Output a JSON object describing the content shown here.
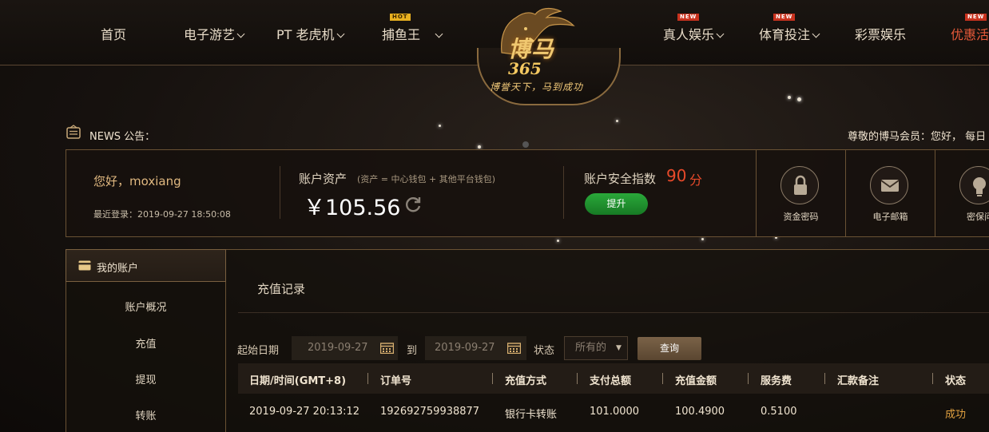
{
  "nav": {
    "left": [
      {
        "label": "首页",
        "dropdown": false
      },
      {
        "label": "电子游艺",
        "dropdown": true
      },
      {
        "label": "PT 老虎机",
        "dropdown": true
      },
      {
        "label": "捕鱼王",
        "dropdown": true,
        "badge": "HOT"
      }
    ],
    "right": [
      {
        "label": "真人娱乐",
        "dropdown": true,
        "badge": "NEW"
      },
      {
        "label": "体育投注",
        "dropdown": true,
        "badge": "NEW"
      },
      {
        "label": "彩票娱乐",
        "dropdown": false
      },
      {
        "label": "优惠活",
        "dropdown": false,
        "badge": "NEW"
      }
    ]
  },
  "logo": {
    "brand": "博马",
    "number": "365",
    "slogan": "博誉天下，马到成功"
  },
  "news": {
    "label": "NEWS 公告：",
    "marquee": "尊敬的博马会员：您好， 每日"
  },
  "account": {
    "greeting": "您好，moxiang",
    "last_login": "最近登录：2019-09-27 18:50:08",
    "assets_label": "账户资产",
    "assets_note": "(资产 = 中心钱包 + 其他平台钱包)",
    "balance": "￥105.56",
    "security_label": "账户安全指数",
    "security_score": "90",
    "security_unit": "分",
    "upgrade_button": "提升",
    "tiles": [
      {
        "label": "资金密码",
        "icon": "lock-icon"
      },
      {
        "label": "电子邮箱",
        "icon": "mail-icon"
      },
      {
        "label": "密保问",
        "icon": "bulb-icon"
      }
    ]
  },
  "sidebar": {
    "title": "我的账户",
    "items": [
      "账户概况",
      "充值",
      "提现",
      "转账"
    ]
  },
  "main": {
    "title": "充值记录",
    "filters": {
      "start_label": "起始日期",
      "start_value": "2019-09-27",
      "to_label": "到",
      "end_value": "2019-09-27",
      "status_label": "状态",
      "status_value": "所有的",
      "query_button": "查询"
    },
    "table": {
      "headers": [
        "日期/时间(GMT+8)",
        "订单号",
        "充值方式",
        "支付总额",
        "充值金额",
        "服务费",
        "汇款备注",
        "状态"
      ],
      "rows": [
        [
          "2019-09-27 20:13:12",
          "19269275993887​7",
          "银行卡转账",
          "101.0000",
          "100.4900",
          "0.5100",
          "",
          "成功"
        ]
      ]
    }
  }
}
